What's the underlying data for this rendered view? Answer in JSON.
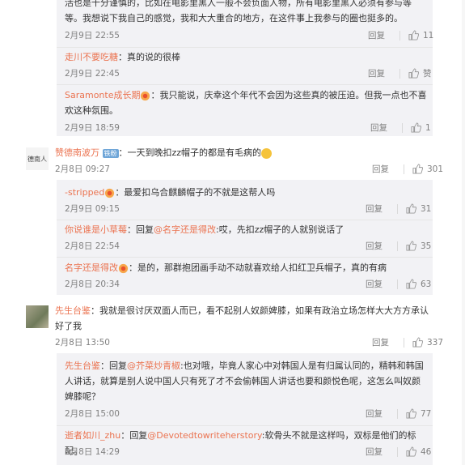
{
  "top_comment": {
    "text": "活也是十分谨慎的，比如在电影里黑人一般不会负面人物，所有电影里黑人必须有参与等等。我想说下我自己的感觉，我和大大重合的地方，在这件事上我参与的圈也挺多的。",
    "time": "2月9日 22:55",
    "reply": "回复",
    "likes": "11"
  },
  "sub_a": [
    {
      "user": "走川不要吃糖",
      "text": "：真的说的很棒",
      "time": "2月9日 22:45",
      "reply": "回复",
      "likes": "赞"
    },
    {
      "user": "Saramonte成长期",
      "text": "：我只能说，庆幸这个年代不会因为这些真的被压迫。但我一点也不喜欢这种氛围。",
      "time": "2月9日 18:59",
      "reply": "回复",
      "likes": "1"
    }
  ],
  "comment2": {
    "user": "赞德南波万",
    "badge": "铁粉",
    "text": "：一天到晚扣zz帽子的都是有毛病的",
    "time": "2月8日 09:27",
    "reply": "回复",
    "likes": "301",
    "avatar_text": "德南人"
  },
  "sub_b": [
    {
      "user": "-stripped",
      "text": "：最爱扣乌合麒麟帽子的不就是这帮人吗",
      "time": "2月9日 09:15",
      "reply": "回复",
      "likes": "31"
    },
    {
      "user": "你说谁是小草莓",
      "text_prefix": "：回复",
      "mention": "@名字还是得改",
      "text": ":哎，先扣zz帽子的人就别说话了",
      "time": "2月8日 22:54",
      "reply": "回复",
      "likes": "35"
    },
    {
      "user": "名字还是得改",
      "text": "：是的，那群抱团画手动不动就喜欢给人扣红卫兵帽子，真的有病",
      "time": "2月8日 20:34",
      "reply": "回复",
      "likes": "63"
    }
  ],
  "comment3": {
    "user": "先生台鉴",
    "text": "：我就是很讨厌双面人而已，看不起别人奴颜婢膝，如果有政治立场怎样大大方方承认好了我",
    "time": "2月8日 13:50",
    "reply": "回复",
    "likes": "337"
  },
  "sub_c": [
    {
      "user": "先生台鉴",
      "text_prefix": "：回复",
      "mention": "@芥菜炒青椒",
      "text": ":也对哦，毕竟人家心中对韩国人是有归属认同的，精韩和韩国人讲话，就算是别人说中国人只有死了才不会偷韩国人讲话也要和颜悦色呢，这怎么叫奴颜婢膝呢？",
      "time": "2月8日 15:00",
      "reply": "回复",
      "likes": "77"
    },
    {
      "user": "逝者如川_zhu",
      "text_prefix": "：回复",
      "mention": "@Devotedtowriteherstory",
      "text": ":软骨头不就是这样吗，双标是他们的标配。",
      "time": "2月8日 14:29",
      "reply": "回复",
      "likes": "46"
    }
  ],
  "colors": {
    "accent": "#eb7350",
    "subbg": "#f2f2f5",
    "meta": "#808080"
  }
}
